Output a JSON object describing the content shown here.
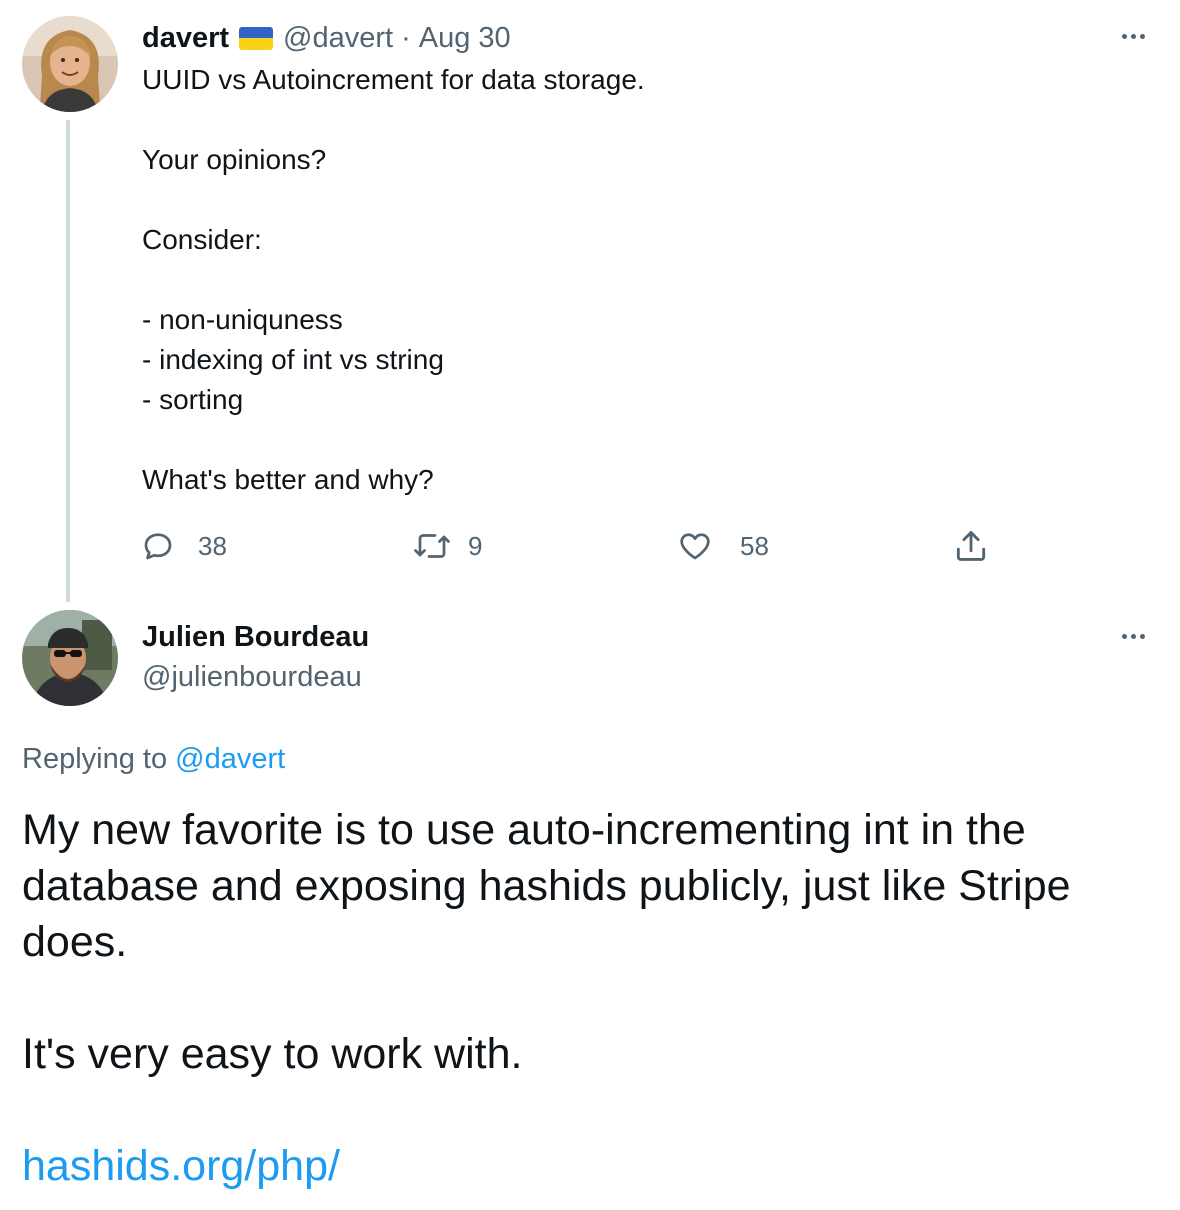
{
  "original_tweet": {
    "author_name": "davert",
    "flag": "ukraine-flag",
    "flag_colors": {
      "top": "#2f63c9",
      "bottom": "#f7d417"
    },
    "handle": "@davert",
    "separator": "·",
    "date": "Aug 30",
    "text": "UUID vs Autoincrement for data storage.\n\nYour opinions?\n\nConsider:\n\n- non-uniquness\n- indexing of int vs string\n- sorting\n\nWhat's better and why?",
    "replies": "38",
    "retweets": "9",
    "likes": "58"
  },
  "reply_tweet": {
    "author_name": "Julien Bourdeau",
    "handle": "@julienbourdeau",
    "replying_prefix": "Replying to",
    "replying_to": "@davert",
    "text": "My new favorite is to use auto-incrementing int in the\ndatabase and exposing hashids publicly, just like Stripe\ndoes.\n\nIt's very easy to work with.",
    "link": "hashids.org/php/"
  },
  "colors": {
    "text": "#0f1419",
    "muted": "#536471",
    "link": "#1d9bf0",
    "thread_line": "#cfd9de"
  },
  "icons": {
    "reply": "reply-bubble-icon",
    "retweet": "retweet-arrows-icon",
    "like": "heart-icon",
    "share": "share-upload-icon",
    "more": "more-dots-icon"
  }
}
